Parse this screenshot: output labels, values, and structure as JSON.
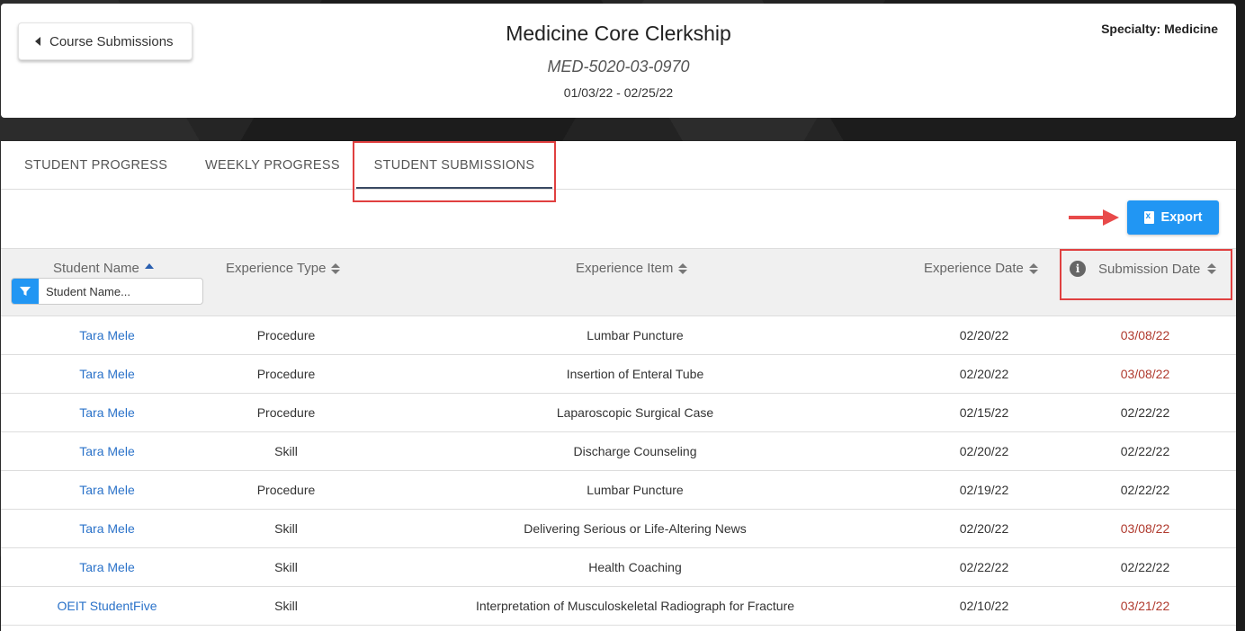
{
  "header": {
    "back_label": "Course Submissions",
    "course_title": "Medicine Core Clerkship",
    "course_code": "MED-5020-03-0970",
    "course_dates": "01/03/22 - 02/25/22",
    "specialty": "Specialty: Medicine"
  },
  "tabs": [
    {
      "label": "STUDENT PROGRESS"
    },
    {
      "label": "WEEKLY PROGRESS"
    },
    {
      "label": "STUDENT SUBMISSIONS",
      "active": true
    }
  ],
  "toolbar": {
    "export_label": "Export"
  },
  "table": {
    "columns": {
      "student_name": "Student Name",
      "experience_type": "Experience Type",
      "experience_item": "Experience Item",
      "experience_date": "Experience Date",
      "submission_date": "Submission Date"
    },
    "filter_placeholder": "Student Name...",
    "rows": [
      {
        "name": "Tara Mele",
        "type": "Procedure",
        "item": "Lumbar Puncture",
        "exp_date": "02/20/22",
        "sub_date": "03/08/22",
        "late": true
      },
      {
        "name": "Tara Mele",
        "type": "Procedure",
        "item": "Insertion of Enteral Tube",
        "exp_date": "02/20/22",
        "sub_date": "03/08/22",
        "late": true
      },
      {
        "name": "Tara Mele",
        "type": "Procedure",
        "item": "Laparoscopic Surgical Case",
        "exp_date": "02/15/22",
        "sub_date": "02/22/22",
        "late": false
      },
      {
        "name": "Tara Mele",
        "type": "Skill",
        "item": "Discharge Counseling",
        "exp_date": "02/20/22",
        "sub_date": "02/22/22",
        "late": false
      },
      {
        "name": "Tara Mele",
        "type": "Procedure",
        "item": "Lumbar Puncture",
        "exp_date": "02/19/22",
        "sub_date": "02/22/22",
        "late": false
      },
      {
        "name": "Tara Mele",
        "type": "Skill",
        "item": "Delivering Serious or Life-Altering News",
        "exp_date": "02/20/22",
        "sub_date": "03/08/22",
        "late": true
      },
      {
        "name": "Tara Mele",
        "type": "Skill",
        "item": "Health Coaching",
        "exp_date": "02/22/22",
        "sub_date": "02/22/22",
        "late": false
      },
      {
        "name": "OEIT StudentFive",
        "type": "Skill",
        "item": "Interpretation of Musculoskeletal Radiograph for Fracture",
        "exp_date": "02/10/22",
        "sub_date": "03/21/22",
        "late": true
      }
    ]
  },
  "colors": {
    "accent": "#2196f3",
    "late": "#b03a2e",
    "link": "#2a72c9",
    "highlight": "#e04040"
  }
}
